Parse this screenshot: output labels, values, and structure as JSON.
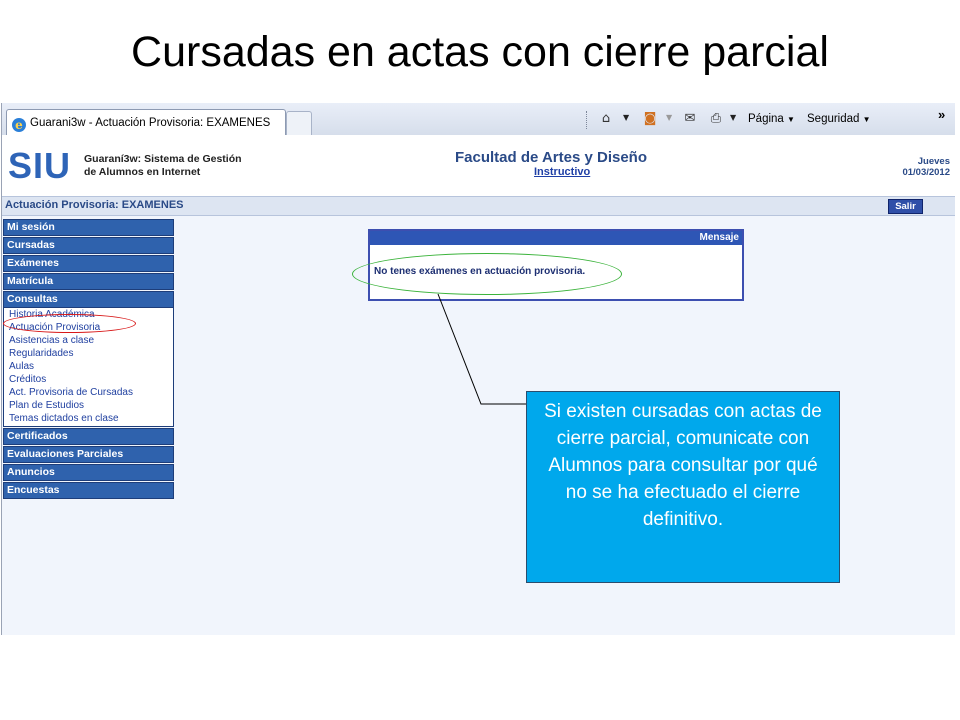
{
  "slide": {
    "title": "Cursadas en actas con cierre parcial"
  },
  "browser": {
    "tab_title": "Guarani3w - Actuación Provisoria: EXAMENES",
    "toolbar": {
      "page_label": "Página",
      "security_label": "Seguridad",
      "overflow": "»"
    }
  },
  "app": {
    "logo": "SIU",
    "system_name_line1": "Guaraní3w: Sistema de Gestión",
    "system_name_line2": "de Alumnos en Internet",
    "faculty": "Facultad de Artes y Diseño",
    "instructivo": "Instructivo",
    "weekday": "Jueves",
    "date": "01/03/2012",
    "section_title": "Actuación Provisoria: EXAMENES",
    "logout": "Salir"
  },
  "menu": {
    "items_top": [
      "Mi sesión",
      "Cursadas",
      "Exámenes",
      "Matrícula",
      "Consultas"
    ],
    "consultas_sub": [
      "Historia Académica",
      "Actuación Provisoria",
      "Asistencias a clase",
      "Regularidades",
      "Aulas",
      "Créditos",
      "Act. Provisoria de Cursadas",
      "Plan de Estudios",
      "Temas dictados en clase"
    ],
    "items_bottom": [
      "Certificados",
      "Evaluaciones Parciales",
      "Anuncios",
      "Encuestas"
    ]
  },
  "message": {
    "header": "Mensaje",
    "text": "No tenes exámenes en actuación provisoria."
  },
  "callout": {
    "text": "Si existen cursadas con actas de cierre parcial, comunicate con Alumnos para consultar por qué no se ha efectuado el cierre definitivo."
  },
  "colors": {
    "callout_bg": "#00a8ec",
    "menu_bg": "#2f62ad",
    "highlight_red": "#d81818",
    "highlight_green": "#3bb33b"
  }
}
